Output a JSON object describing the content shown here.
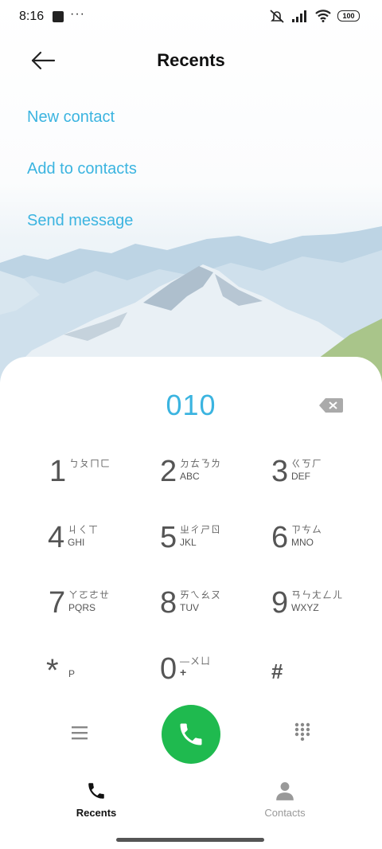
{
  "status_bar": {
    "time": "8:16",
    "more": "···",
    "battery": "100"
  },
  "header": {
    "title": "Recents"
  },
  "options": [
    {
      "label": "New contact"
    },
    {
      "label": "Add to contacts"
    },
    {
      "label": "Send message"
    }
  ],
  "dialer": {
    "entered_number": "010",
    "keys": [
      {
        "digit": "1",
        "zhuyin": "ㄅㄆㄇㄈ",
        "letters": ""
      },
      {
        "digit": "2",
        "zhuyin": "ㄉㄊㄋㄌ",
        "letters": "ABC"
      },
      {
        "digit": "3",
        "zhuyin": "ㄍㄎㄏ",
        "letters": "DEF"
      },
      {
        "digit": "4",
        "zhuyin": "ㄐㄑㄒ",
        "letters": "GHI"
      },
      {
        "digit": "5",
        "zhuyin": "ㄓㄔㄕㄖ",
        "letters": "JKL"
      },
      {
        "digit": "6",
        "zhuyin": "ㄗㄘㄙ",
        "letters": "MNO"
      },
      {
        "digit": "7",
        "zhuyin": "ㄚㄛㄜㄝ",
        "letters": "PQRS"
      },
      {
        "digit": "8",
        "zhuyin": "ㄞㄟㄠㄡ",
        "letters": "TUV"
      },
      {
        "digit": "9",
        "zhuyin": "ㄢㄣㄤㄥㄦ",
        "letters": "WXYZ"
      },
      {
        "digit": "*",
        "zhuyin": "",
        "letters": "P"
      },
      {
        "digit": "0",
        "zhuyin": "—ㄨㄩ",
        "letters": "+"
      },
      {
        "digit": "#",
        "zhuyin": "",
        "letters": ""
      }
    ]
  },
  "bottom_nav": {
    "tabs": [
      {
        "label": "Recents",
        "active": true
      },
      {
        "label": "Contacts",
        "active": false
      }
    ]
  },
  "colors": {
    "accent": "#3bb4e0",
    "call_green": "#1fba4f"
  },
  "icons": [
    "back-arrow-icon",
    "backspace-icon",
    "menu-icon",
    "phone-icon",
    "dialpad-icon",
    "person-icon",
    "wifi-icon",
    "signal-icon",
    "mute-icon"
  ]
}
